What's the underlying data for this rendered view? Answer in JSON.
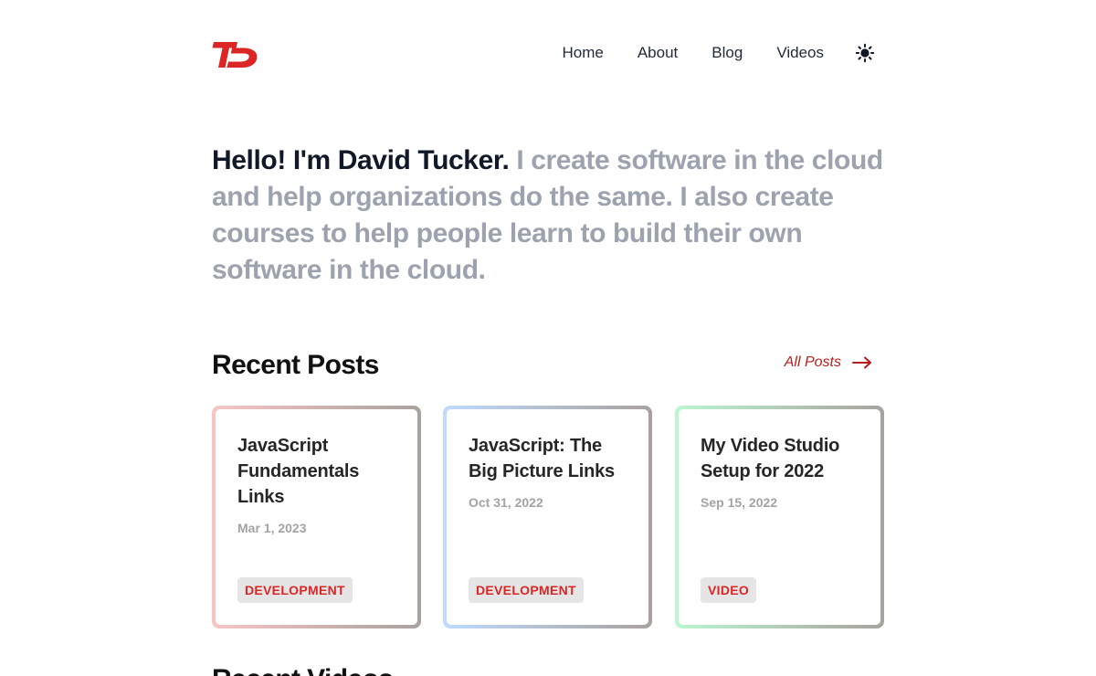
{
  "header": {
    "logo_icon": "td-logo-icon",
    "brand_color": "#dc2626",
    "nav": [
      {
        "label": "Home"
      },
      {
        "label": "About"
      },
      {
        "label": "Blog"
      },
      {
        "label": "Videos"
      }
    ],
    "theme_icon": "sun-icon"
  },
  "intro": {
    "strong": "Hello! I'm David Tucker.",
    "muted": " I create software in the cloud and help organizations do the same. I also create courses to help people learn to build their own software in the cloud."
  },
  "recent_posts": {
    "title": "Recent Posts",
    "all_posts_label": "All Posts",
    "all_posts_icon": "arrow-right-icon",
    "cards": [
      {
        "title": "JavaScript Fundamentals Links",
        "date": "Mar 1, 2023",
        "tag": "DEVELOPMENT",
        "accent": "#f7c5c5"
      },
      {
        "title": "JavaScript: The Big Picture Links",
        "date": "Oct 31, 2022",
        "tag": "DEVELOPMENT",
        "accent": "#bfdbfe"
      },
      {
        "title": "My Video Studio Setup for 2022",
        "date": "Sep 15, 2022",
        "tag": "VIDEO",
        "accent": "#bbf7d0"
      }
    ]
  },
  "next_section": {
    "title": "Recent Videos"
  }
}
